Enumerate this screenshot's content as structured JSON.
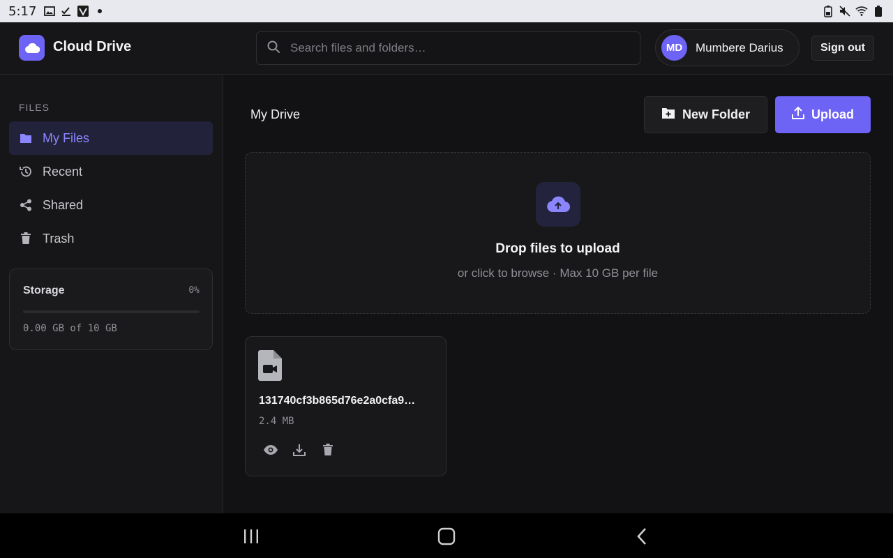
{
  "status_bar": {
    "time": "5:17"
  },
  "header": {
    "app_title": "Cloud Drive",
    "search_placeholder": "Search files and folders…",
    "user": {
      "initials": "MD",
      "name": "Mumbere Darius"
    },
    "sign_out_label": "Sign out"
  },
  "sidebar": {
    "heading": "FILES",
    "items": [
      {
        "label": "My Files",
        "icon": "folder-icon",
        "active": true
      },
      {
        "label": "Recent",
        "icon": "history-icon",
        "active": false
      },
      {
        "label": "Shared",
        "icon": "share-icon",
        "active": false
      },
      {
        "label": "Trash",
        "icon": "trash-icon",
        "active": false
      }
    ],
    "storage": {
      "title": "Storage",
      "percent_label": "0%",
      "used_fraction": 0,
      "used_label": "0.00 GB of 10 GB"
    }
  },
  "main": {
    "breadcrumb": "My Drive",
    "new_folder_label": "New Folder",
    "upload_label": "Upload",
    "dropzone": {
      "title": "Drop files to upload",
      "subtitle": "or click to browse · Max 10 GB per file"
    },
    "files": [
      {
        "name": "131740cf3b865d76e2a0cfa9…",
        "size": "2.4 MB",
        "type": "video"
      }
    ]
  },
  "colors": {
    "accent": "#6D63F5",
    "background": "#121214",
    "surface": "#18181B"
  }
}
